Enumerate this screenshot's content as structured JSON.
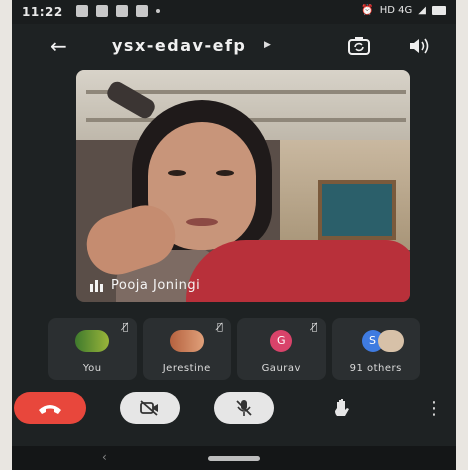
{
  "status_bar": {
    "time": "11:22",
    "right_text": "HD 4G"
  },
  "topbar": {
    "meeting_code": "ysx-edav-efp",
    "back_icon": "arrow-left-icon",
    "camera_switch_icon": "camera-switch-icon",
    "speaker_icon": "speaker-icon"
  },
  "main_video": {
    "speaker_name": "Pooja Joningi"
  },
  "participants": [
    {
      "label": "You",
      "muted": true
    },
    {
      "label": "Jerestine",
      "muted": true
    },
    {
      "label": "Gaurav",
      "initial": "G",
      "muted": true
    },
    {
      "label": "91 others",
      "initial": "S"
    }
  ],
  "controls": {
    "end_call_icon": "end-call-icon",
    "camera_off_icon": "camera-off-icon",
    "mic_off_icon": "mic-off-icon",
    "raise_hand_icon": "raise-hand-icon",
    "more_icon": "more-vertical-icon"
  },
  "colors": {
    "end_call": "#e8473c",
    "background": "#1e2223",
    "tile": "#2b2f31"
  }
}
